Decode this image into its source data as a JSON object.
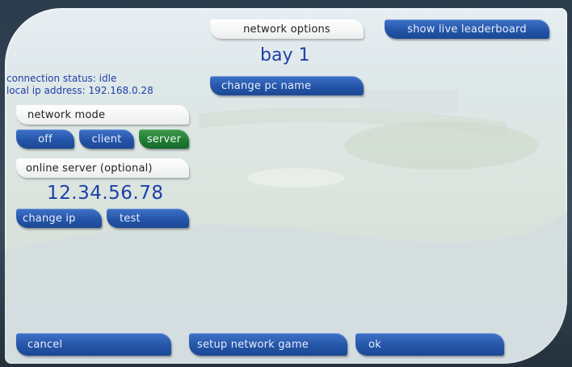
{
  "header": {
    "network_options_label": "network options",
    "leaderboard_button": "show live leaderboard",
    "pc_name": "bay 1",
    "change_pc_name_button": "change pc name"
  },
  "status": {
    "connection_status": "connection status: idle",
    "local_ip": "local ip address: 192.168.0.28"
  },
  "network_mode": {
    "label": "network mode",
    "options": [
      "off",
      "client",
      "server"
    ],
    "selected": "server",
    "selected_color": "#1e7a33"
  },
  "online_server": {
    "label": "online server (optional)",
    "address": "12.34.56.78",
    "change_ip_button": "change ip",
    "test_button": "test"
  },
  "footer": {
    "cancel_button": "cancel",
    "setup_button": "setup network game",
    "ok_button": "ok"
  },
  "colors": {
    "button_blue": "#2455a8",
    "text_blue": "#1f3fa6"
  }
}
